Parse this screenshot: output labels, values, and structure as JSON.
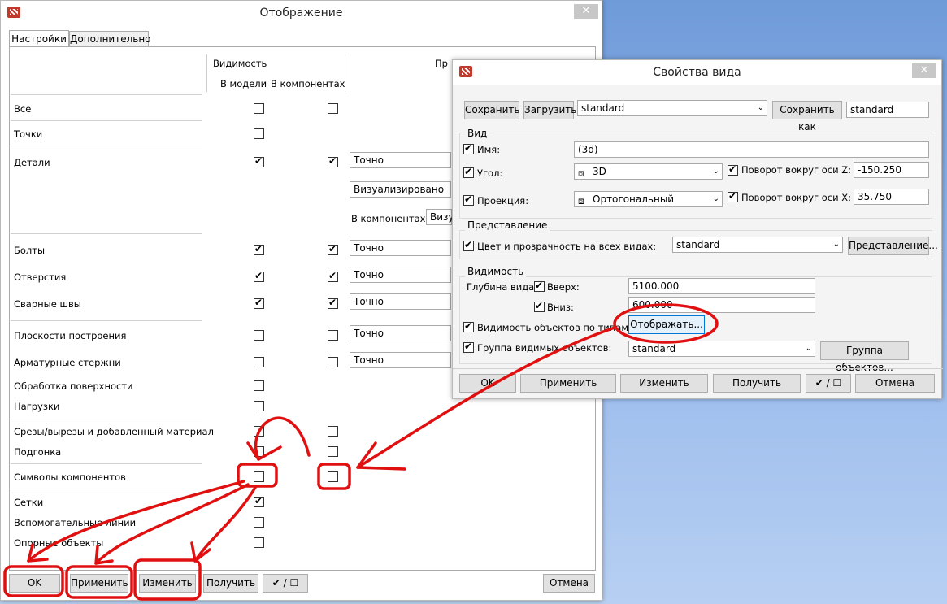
{
  "left_window": {
    "title": "Отображение",
    "close": "✕",
    "tabs": [
      "Настройки",
      "Дополнительно"
    ],
    "headers": {
      "visibility": "Видимость",
      "in_model": "В модели",
      "in_components": "В компонентах",
      "col3": "Пр"
    },
    "rows": [
      {
        "label": "Все",
        "model": false,
        "comp": false
      },
      {
        "label": "Точки",
        "model": false
      },
      {
        "label": "Детали",
        "model": true,
        "comp": true
      },
      {
        "label": "Болты",
        "model": true,
        "comp": true
      },
      {
        "label": "Отверстия",
        "model": true,
        "comp": true
      },
      {
        "label": "Сварные швы",
        "model": true,
        "comp": true
      },
      {
        "label": "Плоскости построения",
        "model": false,
        "comp": false
      },
      {
        "label": "Арматурные стержни",
        "model": false,
        "comp": false
      },
      {
        "label": "Обработка поверхности",
        "model": false
      },
      {
        "label": "Нагрузки",
        "model": false
      },
      {
        "label": "Срезы/вырезы и добавленный материал",
        "model": false,
        "comp": false
      },
      {
        "label": "Подгонка",
        "model": false,
        "comp": false
      },
      {
        "label": "Символы компонентов",
        "model": false,
        "comp": false
      },
      {
        "label": "Сетки",
        "model": true
      },
      {
        "label": "Вспомогательные линии",
        "model": false
      },
      {
        "label": "Опорные объекты",
        "model": false
      }
    ],
    "dropdowns": {
      "exact": "Точно",
      "visualized": "Визуализировано",
      "in_components": "В компонентах:",
      "vis_short": "Визу"
    },
    "buttons": {
      "ok": "OK",
      "apply": "Применить",
      "modify": "Изменить",
      "get": "Получить",
      "toggle": "✔ / ☐",
      "cancel": "Отмена"
    }
  },
  "right_window": {
    "title": "Свойства вида",
    "close": "✕",
    "save": "Сохранить",
    "load": "Загрузить",
    "preset": "standard",
    "save_as": "Сохранить как",
    "save_as_value": "standard",
    "view_group": "Вид",
    "name_label": "Имя:",
    "name_value": "(3d)",
    "angle_label": "Угол:",
    "angle_value": "3D",
    "rotz_label": "Поворот вокруг оси Z:",
    "rotz_value": "-150.250",
    "projection_label": "Проекция:",
    "projection_value": "Ортогональный",
    "rotx_label": "Поворот вокруг оси X:",
    "rotx_value": "35.750",
    "repr_group": "Представление",
    "color_label": "Цвет и прозрачность на всех видах:",
    "color_value": "standard",
    "repr_button": "Представление...",
    "vis_group": "Видимость",
    "depth_label": "Глубина вида:",
    "up_label": "Вверх:",
    "up_value": "5100.000",
    "down_label": "Вниз:",
    "down_value": "600.000",
    "types_label": "Видимость объектов по типам:",
    "show_button": "Отображать...",
    "group_label": "Группа видимых объектов:",
    "group_value": "standard",
    "group_button": "Группа объектов...",
    "buttons": {
      "ok": "OK",
      "apply": "Применить",
      "modify": "Изменить",
      "get": "Получить",
      "toggle": "✔ / ☐",
      "cancel": "Отмена"
    }
  },
  "annotation_color": "#e01010"
}
